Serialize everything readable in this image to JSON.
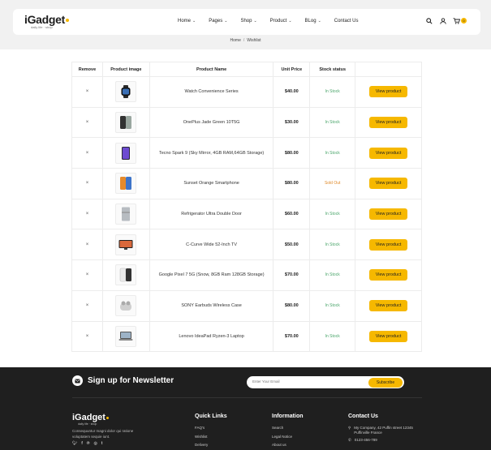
{
  "header": {
    "logo": {
      "brand": "iGadget",
      "tagline": "daily life · shop"
    },
    "nav": [
      {
        "label": "Home",
        "has_dropdown": true
      },
      {
        "label": "Pages",
        "has_dropdown": true
      },
      {
        "label": "Shop",
        "has_dropdown": true
      },
      {
        "label": "Product",
        "has_dropdown": true
      },
      {
        "label": "BLog",
        "has_dropdown": true
      },
      {
        "label": "Contact Us",
        "has_dropdown": false
      }
    ],
    "icons": [
      "search-icon",
      "user-icon",
      "cart-icon"
    ],
    "cart_count": "0"
  },
  "breadcrumb": {
    "home": "Home",
    "current": "Wishlist"
  },
  "table": {
    "headers": [
      "Remove",
      "Product image",
      "Product Name",
      "Unit Price",
      "Stock status",
      ""
    ],
    "remove_symbol": "×",
    "button_label": "View product",
    "rows": [
      {
        "name": "Watch Convenience Series",
        "price": "$40.00",
        "stock": "In Stock",
        "in_stock": true,
        "image": "watch"
      },
      {
        "name": "OnePlus Jade Green 10T5G",
        "price": "$30.00",
        "stock": "In Stock",
        "in_stock": true,
        "image": "phone-dark"
      },
      {
        "name": "Tecno Spark 9 (Sky Mirror, 4GB RAM,64GB Storage)",
        "price": "$80.00",
        "stock": "In Stock",
        "in_stock": true,
        "image": "phone-purple"
      },
      {
        "name": "Sunset Orange Smartphone",
        "price": "$80.00",
        "stock": "Sold Out",
        "in_stock": false,
        "image": "phone-orange"
      },
      {
        "name": "Refrigerator Ultra Double Door",
        "price": "$60.00",
        "stock": "In Stock",
        "in_stock": true,
        "image": "fridge"
      },
      {
        "name": "C-Curve Wide 52-Inch TV",
        "price": "$50.00",
        "stock": "In Stock",
        "in_stock": true,
        "image": "tv"
      },
      {
        "name": "Google Pixel 7 5G (Snow, 8GB Ram 128GB Storage)",
        "price": "$70.00",
        "stock": "In Stock",
        "in_stock": true,
        "image": "pixel"
      },
      {
        "name": "SONY Earbuds Wireless Case",
        "price": "$80.00",
        "stock": "In Stock",
        "in_stock": true,
        "image": "earbuds"
      },
      {
        "name": "Lenovo IdeaPad Ryzen-3 Laptop",
        "price": "$70.00",
        "stock": "In Stock",
        "in_stock": true,
        "image": "laptop"
      }
    ]
  },
  "newsletter": {
    "title": "Sign up for Newsletter",
    "placeholder": "Enter Your Email",
    "button": "Subscribe"
  },
  "footer": {
    "logo": {
      "brand": "iGadget",
      "tagline": "daily life · shop"
    },
    "description": "Consequuntur magni dolor qui ratione voluptatem sequie iunt.",
    "socials": [
      "twitter-icon",
      "facebook-icon",
      "pinterest-icon",
      "instagram-icon",
      "tumblr-icon"
    ],
    "quick_links": {
      "title": "Quick Links",
      "items": [
        "FAQ's",
        "Wishlist",
        "Delivery"
      ]
    },
    "information": {
      "title": "Information",
      "items": [
        "Search",
        "Legal Notice",
        "About us"
      ]
    },
    "contact": {
      "title": "Contact Us",
      "address": "My Company, 42 Puffin street 12345 Puffinville France",
      "phone": "0123-456-789"
    }
  },
  "colors": {
    "accent": "#f6b800",
    "footer_bg": "#1f1f1f",
    "in_stock": "#4aa56a",
    "sold_out": "#e08a2a"
  }
}
